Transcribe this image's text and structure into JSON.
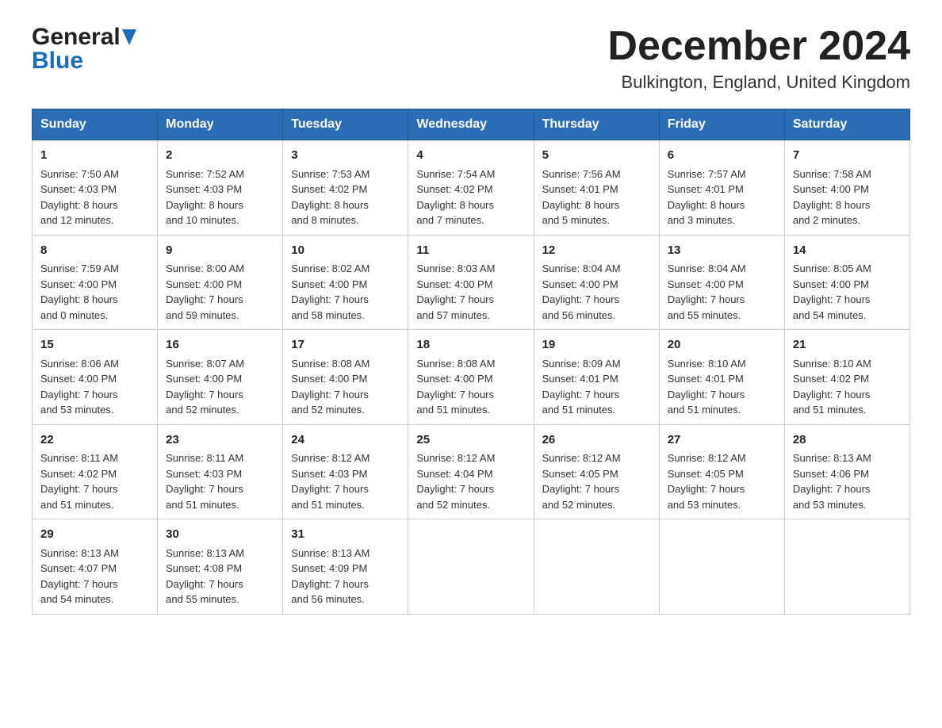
{
  "header": {
    "logo_line1": "General",
    "logo_line2": "Blue",
    "month_title": "December 2024",
    "location": "Bulkington, England, United Kingdom"
  },
  "weekdays": [
    "Sunday",
    "Monday",
    "Tuesday",
    "Wednesday",
    "Thursday",
    "Friday",
    "Saturday"
  ],
  "weeks": [
    [
      {
        "day": "1",
        "sunrise": "Sunrise: 7:50 AM",
        "sunset": "Sunset: 4:03 PM",
        "daylight": "Daylight: 8 hours",
        "daylight2": "and 12 minutes."
      },
      {
        "day": "2",
        "sunrise": "Sunrise: 7:52 AM",
        "sunset": "Sunset: 4:03 PM",
        "daylight": "Daylight: 8 hours",
        "daylight2": "and 10 minutes."
      },
      {
        "day": "3",
        "sunrise": "Sunrise: 7:53 AM",
        "sunset": "Sunset: 4:02 PM",
        "daylight": "Daylight: 8 hours",
        "daylight2": "and 8 minutes."
      },
      {
        "day": "4",
        "sunrise": "Sunrise: 7:54 AM",
        "sunset": "Sunset: 4:02 PM",
        "daylight": "Daylight: 8 hours",
        "daylight2": "and 7 minutes."
      },
      {
        "day": "5",
        "sunrise": "Sunrise: 7:56 AM",
        "sunset": "Sunset: 4:01 PM",
        "daylight": "Daylight: 8 hours",
        "daylight2": "and 5 minutes."
      },
      {
        "day": "6",
        "sunrise": "Sunrise: 7:57 AM",
        "sunset": "Sunset: 4:01 PM",
        "daylight": "Daylight: 8 hours",
        "daylight2": "and 3 minutes."
      },
      {
        "day": "7",
        "sunrise": "Sunrise: 7:58 AM",
        "sunset": "Sunset: 4:00 PM",
        "daylight": "Daylight: 8 hours",
        "daylight2": "and 2 minutes."
      }
    ],
    [
      {
        "day": "8",
        "sunrise": "Sunrise: 7:59 AM",
        "sunset": "Sunset: 4:00 PM",
        "daylight": "Daylight: 8 hours",
        "daylight2": "and 0 minutes."
      },
      {
        "day": "9",
        "sunrise": "Sunrise: 8:00 AM",
        "sunset": "Sunset: 4:00 PM",
        "daylight": "Daylight: 7 hours",
        "daylight2": "and 59 minutes."
      },
      {
        "day": "10",
        "sunrise": "Sunrise: 8:02 AM",
        "sunset": "Sunset: 4:00 PM",
        "daylight": "Daylight: 7 hours",
        "daylight2": "and 58 minutes."
      },
      {
        "day": "11",
        "sunrise": "Sunrise: 8:03 AM",
        "sunset": "Sunset: 4:00 PM",
        "daylight": "Daylight: 7 hours",
        "daylight2": "and 57 minutes."
      },
      {
        "day": "12",
        "sunrise": "Sunrise: 8:04 AM",
        "sunset": "Sunset: 4:00 PM",
        "daylight": "Daylight: 7 hours",
        "daylight2": "and 56 minutes."
      },
      {
        "day": "13",
        "sunrise": "Sunrise: 8:04 AM",
        "sunset": "Sunset: 4:00 PM",
        "daylight": "Daylight: 7 hours",
        "daylight2": "and 55 minutes."
      },
      {
        "day": "14",
        "sunrise": "Sunrise: 8:05 AM",
        "sunset": "Sunset: 4:00 PM",
        "daylight": "Daylight: 7 hours",
        "daylight2": "and 54 minutes."
      }
    ],
    [
      {
        "day": "15",
        "sunrise": "Sunrise: 8:06 AM",
        "sunset": "Sunset: 4:00 PM",
        "daylight": "Daylight: 7 hours",
        "daylight2": "and 53 minutes."
      },
      {
        "day": "16",
        "sunrise": "Sunrise: 8:07 AM",
        "sunset": "Sunset: 4:00 PM",
        "daylight": "Daylight: 7 hours",
        "daylight2": "and 52 minutes."
      },
      {
        "day": "17",
        "sunrise": "Sunrise: 8:08 AM",
        "sunset": "Sunset: 4:00 PM",
        "daylight": "Daylight: 7 hours",
        "daylight2": "and 52 minutes."
      },
      {
        "day": "18",
        "sunrise": "Sunrise: 8:08 AM",
        "sunset": "Sunset: 4:00 PM",
        "daylight": "Daylight: 7 hours",
        "daylight2": "and 51 minutes."
      },
      {
        "day": "19",
        "sunrise": "Sunrise: 8:09 AM",
        "sunset": "Sunset: 4:01 PM",
        "daylight": "Daylight: 7 hours",
        "daylight2": "and 51 minutes."
      },
      {
        "day": "20",
        "sunrise": "Sunrise: 8:10 AM",
        "sunset": "Sunset: 4:01 PM",
        "daylight": "Daylight: 7 hours",
        "daylight2": "and 51 minutes."
      },
      {
        "day": "21",
        "sunrise": "Sunrise: 8:10 AM",
        "sunset": "Sunset: 4:02 PM",
        "daylight": "Daylight: 7 hours",
        "daylight2": "and 51 minutes."
      }
    ],
    [
      {
        "day": "22",
        "sunrise": "Sunrise: 8:11 AM",
        "sunset": "Sunset: 4:02 PM",
        "daylight": "Daylight: 7 hours",
        "daylight2": "and 51 minutes."
      },
      {
        "day": "23",
        "sunrise": "Sunrise: 8:11 AM",
        "sunset": "Sunset: 4:03 PM",
        "daylight": "Daylight: 7 hours",
        "daylight2": "and 51 minutes."
      },
      {
        "day": "24",
        "sunrise": "Sunrise: 8:12 AM",
        "sunset": "Sunset: 4:03 PM",
        "daylight": "Daylight: 7 hours",
        "daylight2": "and 51 minutes."
      },
      {
        "day": "25",
        "sunrise": "Sunrise: 8:12 AM",
        "sunset": "Sunset: 4:04 PM",
        "daylight": "Daylight: 7 hours",
        "daylight2": "and 52 minutes."
      },
      {
        "day": "26",
        "sunrise": "Sunrise: 8:12 AM",
        "sunset": "Sunset: 4:05 PM",
        "daylight": "Daylight: 7 hours",
        "daylight2": "and 52 minutes."
      },
      {
        "day": "27",
        "sunrise": "Sunrise: 8:12 AM",
        "sunset": "Sunset: 4:05 PM",
        "daylight": "Daylight: 7 hours",
        "daylight2": "and 53 minutes."
      },
      {
        "day": "28",
        "sunrise": "Sunrise: 8:13 AM",
        "sunset": "Sunset: 4:06 PM",
        "daylight": "Daylight: 7 hours",
        "daylight2": "and 53 minutes."
      }
    ],
    [
      {
        "day": "29",
        "sunrise": "Sunrise: 8:13 AM",
        "sunset": "Sunset: 4:07 PM",
        "daylight": "Daylight: 7 hours",
        "daylight2": "and 54 minutes."
      },
      {
        "day": "30",
        "sunrise": "Sunrise: 8:13 AM",
        "sunset": "Sunset: 4:08 PM",
        "daylight": "Daylight: 7 hours",
        "daylight2": "and 55 minutes."
      },
      {
        "day": "31",
        "sunrise": "Sunrise: 8:13 AM",
        "sunset": "Sunset: 4:09 PM",
        "daylight": "Daylight: 7 hours",
        "daylight2": "and 56 minutes."
      },
      null,
      null,
      null,
      null
    ]
  ]
}
